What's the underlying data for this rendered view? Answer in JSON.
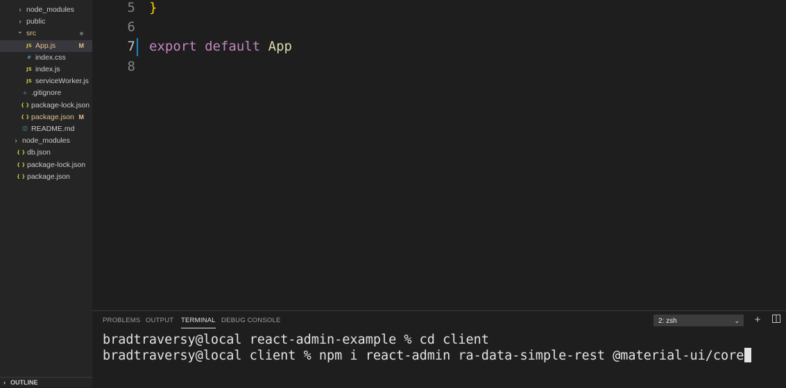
{
  "explorer": {
    "items": [
      {
        "label": "node_modules",
        "type": "folder",
        "expanded": false,
        "indent": 1
      },
      {
        "label": "public",
        "type": "folder",
        "expanded": false,
        "indent": 1
      },
      {
        "label": "src",
        "type": "folder",
        "expanded": true,
        "indent": 1,
        "modified": true
      },
      {
        "label": "App.js",
        "type": "js",
        "indent": 2,
        "modified": true,
        "badge": "M",
        "selected": true
      },
      {
        "label": "index.css",
        "type": "css",
        "indent": 2
      },
      {
        "label": "index.js",
        "type": "js",
        "indent": 2
      },
      {
        "label": "serviceWorker.js",
        "type": "js",
        "indent": 2
      },
      {
        "label": ".gitignore",
        "type": "git",
        "indent": 1
      },
      {
        "label": "package-lock.json",
        "type": "json",
        "indent": 1
      },
      {
        "label": "package.json",
        "type": "json",
        "indent": 1,
        "modified": true,
        "badge": "M"
      },
      {
        "label": "README.md",
        "type": "info",
        "indent": 1
      },
      {
        "label": "node_modules",
        "type": "folder",
        "expanded": false,
        "indent": 0
      },
      {
        "label": "db.json",
        "type": "json",
        "indent": 0
      },
      {
        "label": "package-lock.json",
        "type": "json",
        "indent": 0
      },
      {
        "label": "package.json",
        "type": "json",
        "indent": 0
      }
    ],
    "outline_label": "OUTLINE"
  },
  "editor": {
    "lines": [
      {
        "num": "5",
        "text": "}",
        "active": false
      },
      {
        "num": "6",
        "text": "",
        "active": false
      },
      {
        "num": "7",
        "keyword1": "export",
        "keyword2": "default",
        "identifier": "App",
        "active": true
      },
      {
        "num": "8",
        "text": "",
        "active": false
      }
    ]
  },
  "panel": {
    "tabs": [
      "PROBLEMS",
      "OUTPUT",
      "TERMINAL",
      "DEBUG CONSOLE"
    ],
    "active_tab": "TERMINAL",
    "terminal_select": "2: zsh",
    "terminal_lines": [
      "bradtraversy@local react-admin-example % cd client",
      "bradtraversy@local client % npm i react-admin ra-data-simple-rest @material-ui/core"
    ]
  },
  "colors": {
    "modified": "#e2c08d",
    "keyword": "#c586c0",
    "identifier": "#dcdcaa",
    "brace": "#ffd700"
  }
}
